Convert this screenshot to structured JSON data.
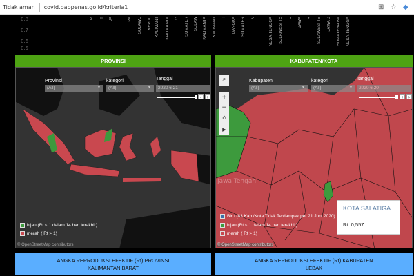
{
  "browser": {
    "security": "Tidak aman",
    "url": "covid.bappenas.go.id/kriteria1"
  },
  "top_chart": {
    "ticks": [
      "0.8",
      "0.7",
      "0.6",
      "0.5"
    ],
    "labels": [
      "M",
      "Y",
      "JA",
      "PA",
      "SULAWE",
      "KEPUL",
      "KALIMANT",
      "KALIMANTA",
      "G",
      "SUMATER",
      "SULAW",
      "KALIMANTA",
      "KALIMANT",
      "I",
      "BANGKA",
      "SUMATER",
      "N",
      "NUSA TENGGA",
      "SULAWESI TE",
      "J",
      "JAWA",
      "B",
      "SULAWESI TE",
      "JAWA B",
      "SUMATERA BA",
      "NUSA TENGGA"
    ]
  },
  "left": {
    "header": "PROVINSI",
    "filters": {
      "provinsi_label": "Provinsi",
      "provinsi_value": "(All)",
      "kategori_label": "kategori",
      "kategori_value": "(All)",
      "tanggal_label": "Tanggal",
      "tanggal_value": "2020 6 21"
    },
    "legend": [
      {
        "label": "hijau (Rt < 1 dalam 14 hari terakhir)",
        "color": "#3d9a3d"
      },
      {
        "label": "merah ( Rt > 1)",
        "color": "#c9484f"
      }
    ],
    "attribution": "© OpenStreetMap contributors",
    "footer_title": "ANGKA REPRODUKSI EFEKTIF (Rt) PROVINSI",
    "footer_value": "KALIMANTAN BARAT"
  },
  "right": {
    "header": "KABUPATEN/KOTA",
    "filters": {
      "kabupaten_label": "Kabupaten",
      "kabupaten_value": "(All)",
      "kategori_label": "kategori",
      "kategori_value": "(All)",
      "tanggal_label": "Tanggal",
      "tanggal_value": "2020 6 20"
    },
    "legend": [
      {
        "label": "Biru (83 Kab./Kota Tidak Terdampak per 21 Juni 2020)",
        "color": "#3b6ea8"
      },
      {
        "label": "hijau (Rt < 1 dalam 14 hari terakhir)",
        "color": "#3d9a3d"
      },
      {
        "label": "merah ( Rt > 1)",
        "color": "#c9484f"
      }
    ],
    "map_label": "Jawa Tengah",
    "attribution": "© OpenStreetMap contributors",
    "tooltip": {
      "title": "KOTA SALATIGA",
      "value": "Rt: 0,557"
    },
    "footer_title": "ANGKA REPRODUKSI EFEKTIF (Rt) KABUPATEN",
    "footer_value": "LEBAK"
  },
  "colors": {
    "green_header": "#4ea313",
    "footer_blue": "#5aaeff",
    "red": "#c9484f",
    "green": "#3d9a3d"
  }
}
